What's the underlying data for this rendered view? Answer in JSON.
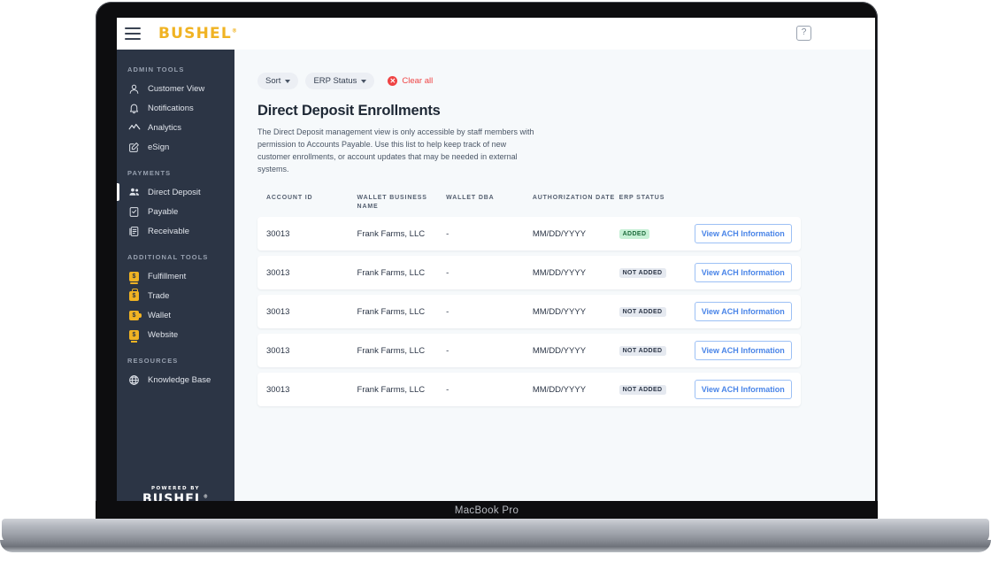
{
  "device": {
    "label": "MacBook Pro"
  },
  "topbar": {
    "menu_icon": "hamburger-icon",
    "brand": "BUSHEL",
    "brand_mark": "®",
    "help_icon": "question-mark-icon",
    "help_glyph": "?"
  },
  "sidebar": {
    "sections": [
      {
        "title": "ADMIN TOOLS",
        "items": [
          {
            "label": "Customer View",
            "icon": "user-icon",
            "active": false
          },
          {
            "label": "Notifications",
            "icon": "bell-icon",
            "active": false
          },
          {
            "label": "Analytics",
            "icon": "line-chart-icon",
            "active": false
          },
          {
            "label": "eSign",
            "icon": "pencil-square-icon",
            "active": false
          }
        ]
      },
      {
        "title": "PAYMENTS",
        "items": [
          {
            "label": "Direct Deposit",
            "icon": "users-icon",
            "active": true
          },
          {
            "label": "Payable",
            "icon": "document-check-icon",
            "active": false
          },
          {
            "label": "Receivable",
            "icon": "document-stack-icon",
            "active": false
          }
        ]
      },
      {
        "title": "ADDITIONAL TOOLS",
        "items": [
          {
            "label": "Fulfillment",
            "icon": "bushel-fulfillment-icon",
            "active": false
          },
          {
            "label": "Trade",
            "icon": "bushel-trade-icon",
            "active": false
          },
          {
            "label": "Wallet",
            "icon": "bushel-wallet-icon",
            "active": false
          },
          {
            "label": "Website",
            "icon": "bushel-website-icon",
            "active": false
          }
        ]
      },
      {
        "title": "RESOURCES",
        "items": [
          {
            "label": "Knowledge Base",
            "icon": "globe-icon",
            "active": false
          }
        ]
      }
    ],
    "footer": {
      "powered_by": "POWERED BY",
      "brand": "BUSHEL",
      "brand_mark": "®"
    }
  },
  "filters": {
    "sort": {
      "label": "Sort",
      "icon": "chevron-down-icon"
    },
    "erp_status": {
      "label": "ERP Status",
      "icon": "chevron-down-icon"
    },
    "clear_all": {
      "label": "Clear all",
      "icon": "x-circle-icon",
      "glyph": "✕"
    }
  },
  "page": {
    "title": "Direct Deposit Enrollments",
    "description": "The Direct Deposit management view is only accessible by staff members with permission to Accounts Payable. Use this list to help keep track of new customer enrollments, or account updates that may be needed in external systems."
  },
  "table": {
    "columns": [
      "ACCOUNT ID",
      "WALLET BUSINESS NAME",
      "WALLET DBA",
      "AUTHORIZATION DATE",
      "ERP STATUS",
      ""
    ],
    "action_label": "View ACH Information",
    "rows": [
      {
        "account_id": "30013",
        "business_name": "Frank Farms, LLC",
        "dba": "-",
        "auth_date": "MM/DD/YYYY",
        "erp_status": "ADDED",
        "erp_state": "added"
      },
      {
        "account_id": "30013",
        "business_name": "Frank Farms, LLC",
        "dba": "-",
        "auth_date": "MM/DD/YYYY",
        "erp_status": "NOT ADDED",
        "erp_state": "notadded"
      },
      {
        "account_id": "30013",
        "business_name": "Frank Farms, LLC",
        "dba": "-",
        "auth_date": "MM/DD/YYYY",
        "erp_status": "NOT ADDED",
        "erp_state": "notadded"
      },
      {
        "account_id": "30013",
        "business_name": "Frank Farms, LLC",
        "dba": "-",
        "auth_date": "MM/DD/YYYY",
        "erp_status": "NOT ADDED",
        "erp_state": "notadded"
      },
      {
        "account_id": "30013",
        "business_name": "Frank Farms, LLC",
        "dba": "-",
        "auth_date": "MM/DD/YYYY",
        "erp_status": "NOT ADDED",
        "erp_state": "notadded"
      }
    ]
  },
  "colors": {
    "brand_gold": "#f0b323",
    "sidebar_bg": "#2c3545",
    "canvas_bg": "#f6f9fb",
    "accent_blue": "#4a85e8",
    "danger_red": "#ef4444",
    "badge_added_bg": "#c7f0d6",
    "badge_added_text": "#1d6b3c",
    "badge_notadded_bg": "#e5e9f0"
  }
}
